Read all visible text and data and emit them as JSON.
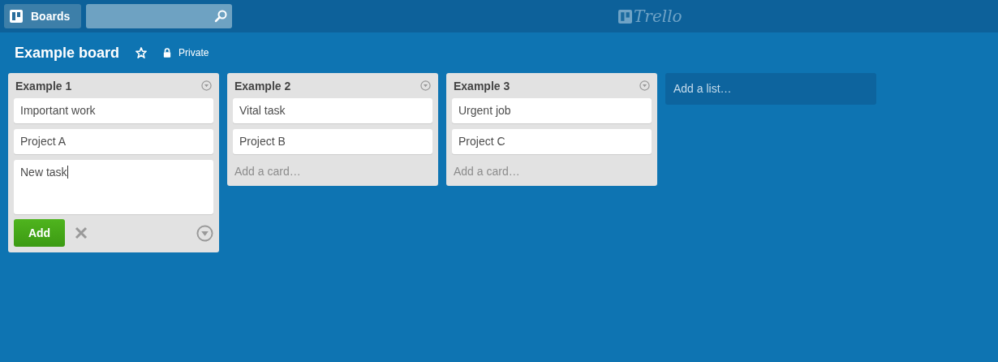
{
  "header": {
    "boards_button": "Boards",
    "logo": "Trello"
  },
  "board": {
    "title": "Example board",
    "starred": false,
    "visibility": "Private"
  },
  "lists": [
    {
      "title": "Example 1",
      "cards": [
        "Important work",
        "Project A"
      ],
      "composer": {
        "value": "New task",
        "add_button": "Add"
      }
    },
    {
      "title": "Example 2",
      "cards": [
        "Vital task",
        "Project B"
      ],
      "add_card": "Add a card…"
    },
    {
      "title": "Example 3",
      "cards": [
        "Urgent job",
        "Project C"
      ],
      "add_card": "Add a card…"
    }
  ],
  "add_list": "Add a list…"
}
